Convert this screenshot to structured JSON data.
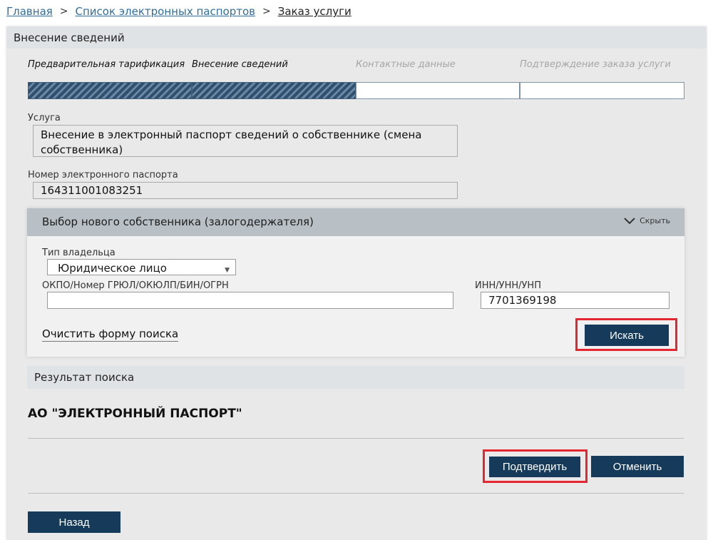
{
  "breadcrumb": {
    "home": "Главная",
    "list": "Список электронных паспортов",
    "current": "Заказ услуги",
    "separator": ">"
  },
  "panel": {
    "title": "Внесение сведений"
  },
  "steps": [
    {
      "label": "Предварительная тарификация",
      "state": "done"
    },
    {
      "label": "Внесение сведений",
      "state": "done"
    },
    {
      "label": "Контактные данные",
      "state": "todo"
    },
    {
      "label": "Подтверждение заказа услуги",
      "state": "todo"
    }
  ],
  "fields": {
    "service_label": "Услуга",
    "service_value": "Внесение в электронный паспорт сведений о собственнике (смена собственника)",
    "passport_label": "Номер электронного паспорта",
    "passport_value": "164311001083251"
  },
  "owner_search": {
    "title": "Выбор нового собственника (залогодержателя)",
    "collapse_label": "Скрыть",
    "owner_type_label": "Тип владельца",
    "owner_type_value": "Юридическое лицо",
    "okpo_label": "ОКПО/Номер ГРЮЛ/ОКЮЛП/БИН/ОГРН",
    "okpo_value": "",
    "inn_label": "ИНН/УНН/УНП",
    "inn_value": "7701369198",
    "clear_label": "Очистить форму поиска",
    "search_label": "Искать"
  },
  "result": {
    "title": "Результат поиска",
    "name": "АО \"ЭЛЕКТРОННЫЙ ПАСПОРТ\"",
    "confirm_label": "Подтвердить",
    "cancel_label": "Отменить"
  },
  "back_label": "Назад",
  "colors": {
    "accent": "#153a5a",
    "link": "#2f6e9c",
    "highlight": "#e3262f"
  }
}
